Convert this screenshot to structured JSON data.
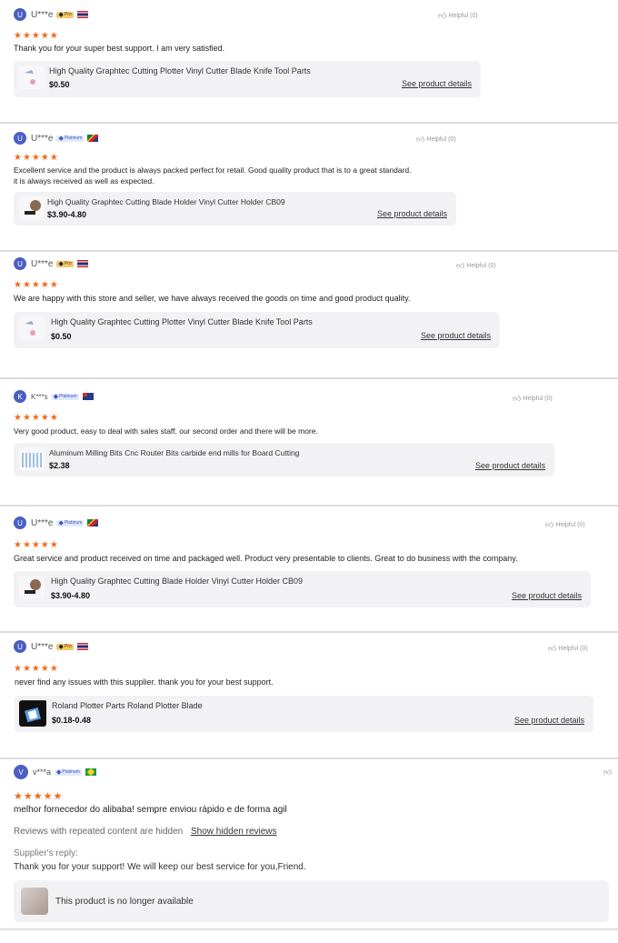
{
  "reviews": [
    {
      "initial": "U",
      "user": "U***e",
      "badge": "Pro",
      "flag": "th",
      "helpful": "Helpful (0)",
      "stars": "★★★★★",
      "text": "Thank you for your super best support. I am very satisfied.",
      "product": {
        "name": "High Quality Graphtec Cutting Plotter Vinyl Cutter Blade Knife Tool Parts",
        "price": "$0.50",
        "link": "See product details"
      }
    },
    {
      "initial": "U",
      "user": "U***e",
      "badge": "Platinum",
      "flag": "za",
      "helpful": "Helpful (0)",
      "stars": "★★★★★",
      "text": "Excellent service and the product is always packed perfect for retail. Good quality product that is to a great standard.",
      "text2": "it is always received as well as expected.",
      "product": {
        "name": "High Quality Graphtec Cutting Blade Holder Vinyl Cutter Holder CB09",
        "price": "$3.90-4.80",
        "link": "See product details"
      }
    },
    {
      "initial": "U",
      "user": "U***e",
      "badge": "Pro",
      "flag": "th",
      "helpful": "Helpful (0)",
      "stars": "★★★★★",
      "text": "We are happy with this store and seller, we have always received the goods on time and good product quality.",
      "product": {
        "name": "High Quality Graphtec Cutting Plotter Vinyl Cutter Blade Knife Tool Parts",
        "price": "$0.50",
        "link": "See product details"
      }
    },
    {
      "initial": "K",
      "user": "K***s",
      "badge": "Platinum",
      "flag": "au",
      "helpful": "Helpful (0)",
      "stars": "★★★★★",
      "text": "Very good product, easy to deal with sales staff, our second order and there will be more.",
      "product": {
        "name": "Aluminum Milling Bits Cnc Router Bits carbide end mills for Board Cutting",
        "price": "$2.38",
        "link": "See product details"
      }
    },
    {
      "initial": "U",
      "user": "U***e",
      "badge": "Platinum",
      "flag": "za",
      "helpful": "Helpful (0)",
      "stars": "★★★★★",
      "text": "Great service and product received on time and packaged well. Product very presentable to clients. Great to do business with the company.",
      "product": {
        "name": "High Quality Graphtec Cutting Blade Holder Vinyl Cutter Holder CB09",
        "price": "$3.90-4.80",
        "link": "See product details"
      }
    },
    {
      "initial": "U",
      "user": "U***e",
      "badge": "Pro",
      "flag": "th",
      "helpful": "Helpful (0)",
      "stars": "★★★★★",
      "text": "never find any issues with this supplier. thank you for your best support.",
      "product": {
        "name": "Roland Plotter Parts Roland Plotter Blade",
        "price": "$0.18-0.48",
        "link": "See product details"
      }
    },
    {
      "initial": "V",
      "user": "v***a",
      "badge": "Platinum",
      "flag": "br",
      "stars": "★★★★★",
      "text": "melhor fornecedor do alibaba! sempre enviou rápido e de forma agil",
      "hidden_note": "Reviews with repeated content are hidden",
      "hidden_link": "Show hidden reviews",
      "reply_label": "Supplier's reply:",
      "reply_text": "Thank you for your support! We will keep our best service for you,Friend.",
      "unavailable": "This product is no longer available"
    }
  ],
  "colors": {
    "star": "#f26a1b",
    "avatar": "#4a5fc1",
    "card": "#f2f2f4"
  }
}
